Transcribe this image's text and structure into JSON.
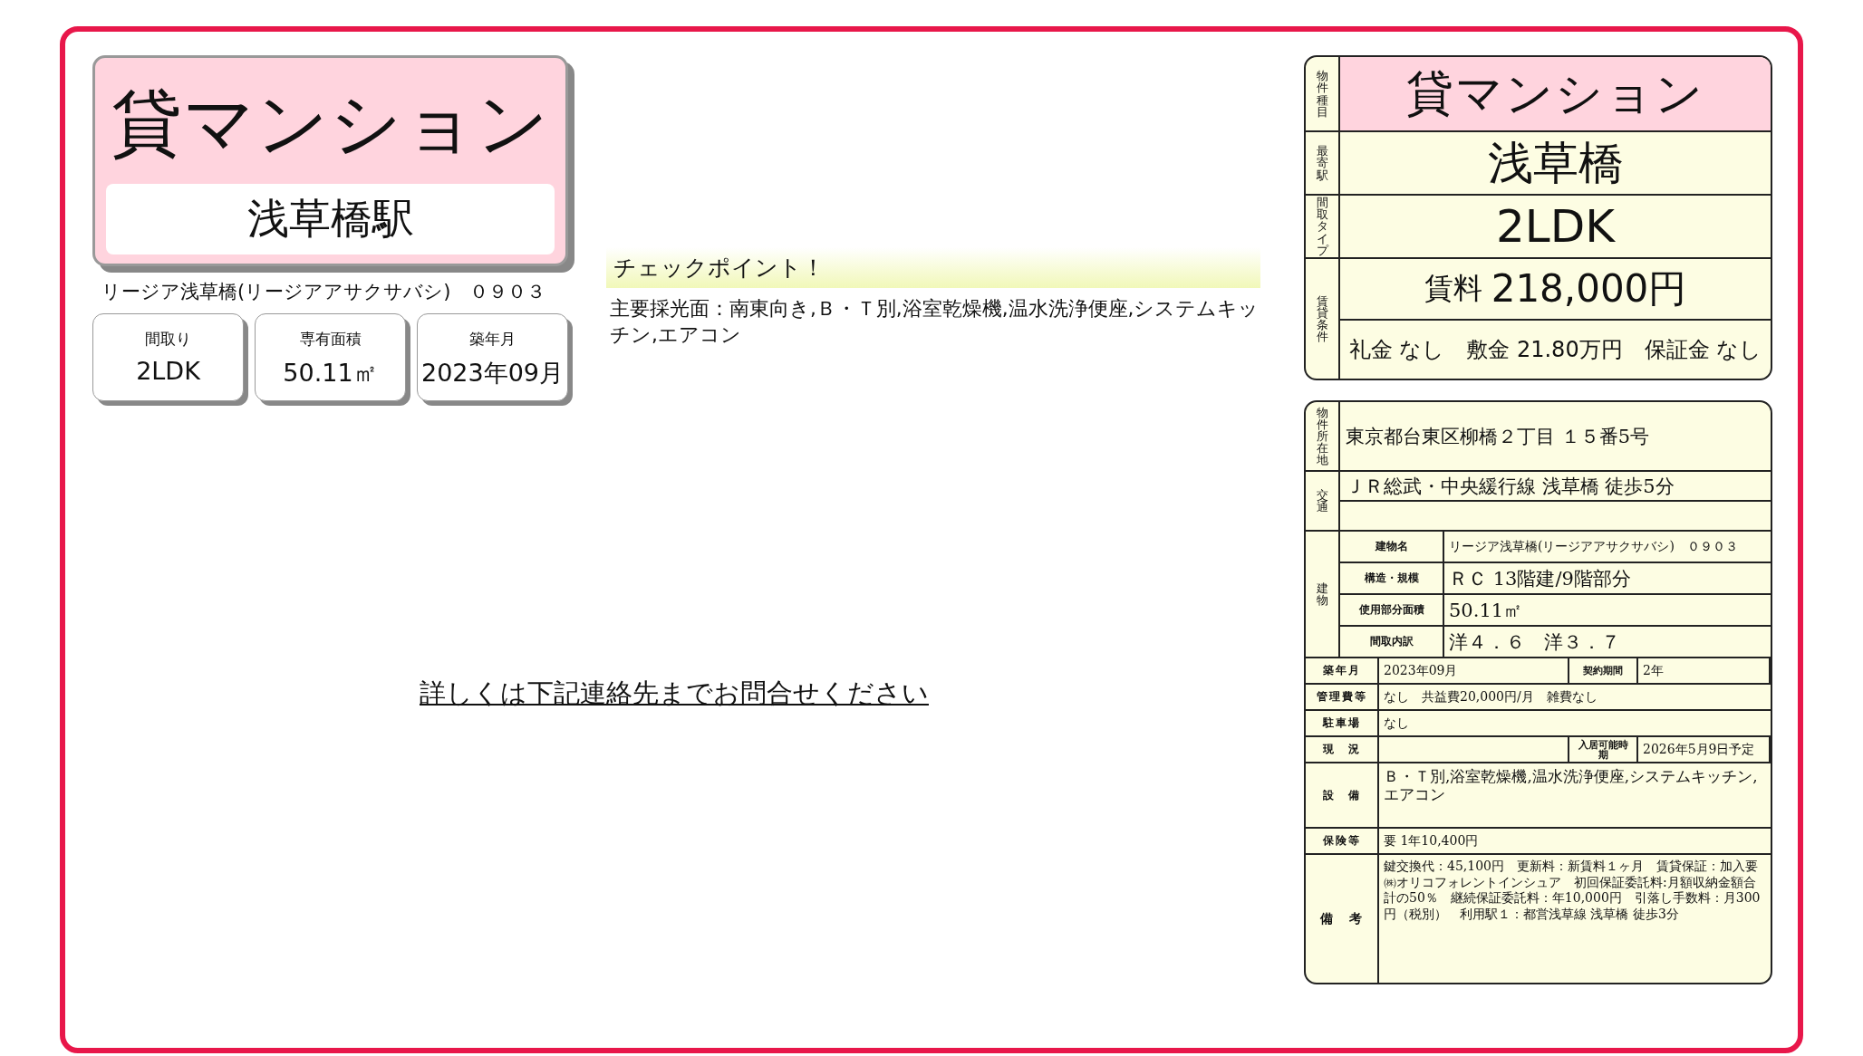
{
  "title_card": {
    "type": "貸マンション",
    "station": "浅草橋駅"
  },
  "building_name": "リージア浅草橋(リージアアサクサバシ)　０９０３",
  "summary": [
    {
      "label": "間取り",
      "value": "2LDK"
    },
    {
      "label": "専有面積",
      "value": "50.11㎡"
    },
    {
      "label": "築年月",
      "value": "2023年09月"
    }
  ],
  "checkpoint": {
    "heading": "チェックポイント！",
    "text": "主要採光面：南東向き,Ｂ・Ｔ別,浴室乾燥機,温水洗浄便座,システムキッチン,エアコン"
  },
  "contact_link": "詳しくは下記連絡先までお問合せください",
  "overview": [
    {
      "label": "物件種目",
      "kind": "type",
      "value": "貸マンション"
    },
    {
      "label": "最寄駅",
      "kind": "plain",
      "value": "浅草橋"
    },
    {
      "label": "間取タイプ",
      "kind": "plain",
      "value": "2LDK"
    },
    {
      "label": "賃貸条件",
      "kind": "rent",
      "rent_label": "賃料",
      "rent": "218,000円",
      "fees": [
        {
          "label": "礼金",
          "value": "なし"
        },
        {
          "label": "敷金",
          "value": "21.80万円"
        },
        {
          "label": "保証金",
          "value": "なし"
        }
      ]
    }
  ],
  "details": {
    "address": {
      "label": "物件所在地",
      "value": "東京都台東区柳橋２丁目 １５番5号"
    },
    "access": {
      "label": "交通",
      "lines": [
        "ＪＲ総武・中央緩行線 浅草橋 徒歩5分"
      ]
    },
    "building": {
      "label": "建物",
      "rows": [
        {
          "label": "建物名",
          "value": "リージア浅草橋(リージアアサクサバシ)　０９０３",
          "kind": "small"
        },
        {
          "label": "構造・規模",
          "value": "ＲＣ 13階建/9階部分",
          "kind": "large"
        },
        {
          "label": "使用部分面積",
          "value": "50.11㎡",
          "kind": "large"
        },
        {
          "label": "間取内訳",
          "value": "洋４．６　洋３．７",
          "kind": "large"
        }
      ]
    },
    "rows": [
      {
        "label": "築年月",
        "kind": "line",
        "value": "2023年09月",
        "extra_label": "契約期間",
        "extra_value": "2年"
      },
      {
        "label": "管理費等",
        "kind": "line",
        "value": "なし　共益費20,000円/月　雑費なし"
      },
      {
        "label": "駐車場",
        "kind": "line",
        "value": "なし"
      },
      {
        "label": "現　況",
        "kind": "line",
        "extra_label": "入居可能時期",
        "extra_value": "2026年5月9日予定"
      },
      {
        "label": "設　備",
        "kind": "block",
        "value": "Ｂ・Ｔ別,浴室乾燥機,温水洗浄便座,システムキッチン,エアコン"
      },
      {
        "label": "保険等",
        "kind": "line",
        "value": "要 1年10,400円"
      },
      {
        "label": "備　考",
        "kind": "memo",
        "value": "鍵交換代：45,100円　更新料：新賃料１ヶ月　賃貸保証：加入要㈱オリコフォレントインシュア　初回保証委託料:月額収納金額合計の50％　継続保証委託料：年10,000円　引落し手数料：月300円（税別）　利用駅１：都営浅草線 浅草橋 徒歩3分"
      }
    ]
  }
}
